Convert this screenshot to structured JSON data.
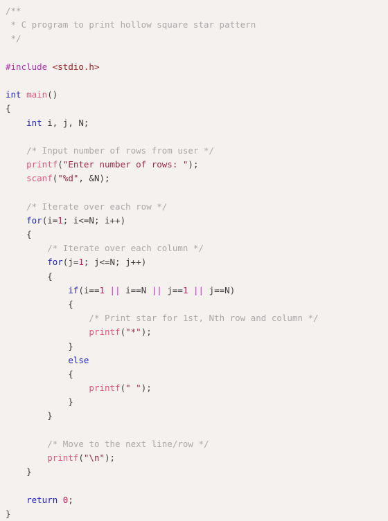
{
  "editor": {
    "language": "C",
    "background_color": "#f5f1ef",
    "colors": {
      "plain": "#3c3c3c",
      "comment": "#a9a9a9",
      "keyword": "#2222cc",
      "function": "#e8557f",
      "string": "#a2294a",
      "number": "#d1145a",
      "operator": "#c72ac7",
      "preprocessor": "#b32fb3",
      "header": "#a02020"
    }
  },
  "code": {
    "lines": [
      {
        "id": 1,
        "tokens": [
          {
            "t": "/**",
            "c": "comment"
          }
        ]
      },
      {
        "id": 2,
        "tokens": [
          {
            "t": " * C program to print hollow square star pattern",
            "c": "comment"
          }
        ]
      },
      {
        "id": 3,
        "tokens": [
          {
            "t": " */",
            "c": "comment"
          }
        ]
      },
      {
        "id": 4,
        "tokens": []
      },
      {
        "id": 5,
        "tokens": [
          {
            "t": "#include",
            "c": "preproc"
          },
          {
            "t": " ",
            "c": "plain"
          },
          {
            "t": "<stdio.h>",
            "c": "header"
          }
        ]
      },
      {
        "id": 6,
        "tokens": []
      },
      {
        "id": 7,
        "tokens": [
          {
            "t": "int",
            "c": "keyword"
          },
          {
            "t": " ",
            "c": "plain"
          },
          {
            "t": "main",
            "c": "function"
          },
          {
            "t": "()",
            "c": "plain"
          }
        ]
      },
      {
        "id": 8,
        "tokens": [
          {
            "t": "{",
            "c": "plain"
          }
        ]
      },
      {
        "id": 9,
        "tokens": [
          {
            "t": "    ",
            "c": "plain"
          },
          {
            "t": "int",
            "c": "keyword"
          },
          {
            "t": " i, j, N;",
            "c": "plain"
          }
        ]
      },
      {
        "id": 10,
        "tokens": []
      },
      {
        "id": 11,
        "tokens": [
          {
            "t": "    ",
            "c": "plain"
          },
          {
            "t": "/* Input number of rows from user */",
            "c": "comment"
          }
        ]
      },
      {
        "id": 12,
        "tokens": [
          {
            "t": "    ",
            "c": "plain"
          },
          {
            "t": "printf",
            "c": "function"
          },
          {
            "t": "(",
            "c": "plain"
          },
          {
            "t": "\"Enter number of rows: \"",
            "c": "string"
          },
          {
            "t": ");",
            "c": "plain"
          }
        ]
      },
      {
        "id": 13,
        "tokens": [
          {
            "t": "    ",
            "c": "plain"
          },
          {
            "t": "scanf",
            "c": "function"
          },
          {
            "t": "(",
            "c": "plain"
          },
          {
            "t": "\"%d\"",
            "c": "string"
          },
          {
            "t": ", &N);",
            "c": "plain"
          }
        ]
      },
      {
        "id": 14,
        "tokens": []
      },
      {
        "id": 15,
        "tokens": [
          {
            "t": "    ",
            "c": "plain"
          },
          {
            "t": "/* Iterate over each row */",
            "c": "comment"
          }
        ]
      },
      {
        "id": 16,
        "tokens": [
          {
            "t": "    ",
            "c": "plain"
          },
          {
            "t": "for",
            "c": "keyword"
          },
          {
            "t": "(i=",
            "c": "plain"
          },
          {
            "t": "1",
            "c": "number"
          },
          {
            "t": "; i<=N; i++)",
            "c": "plain"
          }
        ]
      },
      {
        "id": 17,
        "tokens": [
          {
            "t": "    {",
            "c": "plain"
          }
        ]
      },
      {
        "id": 18,
        "tokens": [
          {
            "t": "        ",
            "c": "plain"
          },
          {
            "t": "/* Iterate over each column */",
            "c": "comment"
          }
        ]
      },
      {
        "id": 19,
        "tokens": [
          {
            "t": "        ",
            "c": "plain"
          },
          {
            "t": "for",
            "c": "keyword"
          },
          {
            "t": "(j=",
            "c": "plain"
          },
          {
            "t": "1",
            "c": "number"
          },
          {
            "t": "; j<=N; j++)",
            "c": "plain"
          }
        ]
      },
      {
        "id": 20,
        "tokens": [
          {
            "t": "        {",
            "c": "plain"
          }
        ]
      },
      {
        "id": 21,
        "tokens": [
          {
            "t": "            ",
            "c": "plain"
          },
          {
            "t": "if",
            "c": "keyword"
          },
          {
            "t": "(i==",
            "c": "plain"
          },
          {
            "t": "1",
            "c": "number"
          },
          {
            "t": " ",
            "c": "plain"
          },
          {
            "t": "||",
            "c": "operator"
          },
          {
            "t": " i==N ",
            "c": "plain"
          },
          {
            "t": "||",
            "c": "operator"
          },
          {
            "t": " j==",
            "c": "plain"
          },
          {
            "t": "1",
            "c": "number"
          },
          {
            "t": " ",
            "c": "plain"
          },
          {
            "t": "||",
            "c": "operator"
          },
          {
            "t": " j==N)",
            "c": "plain"
          }
        ]
      },
      {
        "id": 22,
        "tokens": [
          {
            "t": "            {",
            "c": "plain"
          }
        ]
      },
      {
        "id": 23,
        "tokens": [
          {
            "t": "                ",
            "c": "plain"
          },
          {
            "t": "/* Print star for 1st, Nth row and column */",
            "c": "comment"
          }
        ]
      },
      {
        "id": 24,
        "tokens": [
          {
            "t": "                ",
            "c": "plain"
          },
          {
            "t": "printf",
            "c": "function"
          },
          {
            "t": "(",
            "c": "plain"
          },
          {
            "t": "\"*\"",
            "c": "string"
          },
          {
            "t": ");",
            "c": "plain"
          }
        ]
      },
      {
        "id": 25,
        "tokens": [
          {
            "t": "            }",
            "c": "plain"
          }
        ]
      },
      {
        "id": 26,
        "tokens": [
          {
            "t": "            ",
            "c": "plain"
          },
          {
            "t": "else",
            "c": "keyword"
          }
        ]
      },
      {
        "id": 27,
        "tokens": [
          {
            "t": "            {",
            "c": "plain"
          }
        ]
      },
      {
        "id": 28,
        "tokens": [
          {
            "t": "                ",
            "c": "plain"
          },
          {
            "t": "printf",
            "c": "function"
          },
          {
            "t": "(",
            "c": "plain"
          },
          {
            "t": "\" \"",
            "c": "string"
          },
          {
            "t": ");",
            "c": "plain"
          }
        ]
      },
      {
        "id": 29,
        "tokens": [
          {
            "t": "            }",
            "c": "plain"
          }
        ]
      },
      {
        "id": 30,
        "tokens": [
          {
            "t": "        }",
            "c": "plain"
          }
        ]
      },
      {
        "id": 31,
        "tokens": []
      },
      {
        "id": 32,
        "tokens": [
          {
            "t": "        ",
            "c": "plain"
          },
          {
            "t": "/* Move to the next line/row */",
            "c": "comment"
          }
        ]
      },
      {
        "id": 33,
        "tokens": [
          {
            "t": "        ",
            "c": "plain"
          },
          {
            "t": "printf",
            "c": "function"
          },
          {
            "t": "(",
            "c": "plain"
          },
          {
            "t": "\"\\n\"",
            "c": "string"
          },
          {
            "t": ");",
            "c": "plain"
          }
        ]
      },
      {
        "id": 34,
        "tokens": [
          {
            "t": "    }",
            "c": "plain"
          }
        ]
      },
      {
        "id": 35,
        "tokens": []
      },
      {
        "id": 36,
        "tokens": [
          {
            "t": "    ",
            "c": "plain"
          },
          {
            "t": "return",
            "c": "keyword"
          },
          {
            "t": " ",
            "c": "plain"
          },
          {
            "t": "0",
            "c": "number"
          },
          {
            "t": ";",
            "c": "plain"
          }
        ]
      },
      {
        "id": 37,
        "tokens": [
          {
            "t": "}",
            "c": "plain"
          }
        ]
      }
    ]
  }
}
